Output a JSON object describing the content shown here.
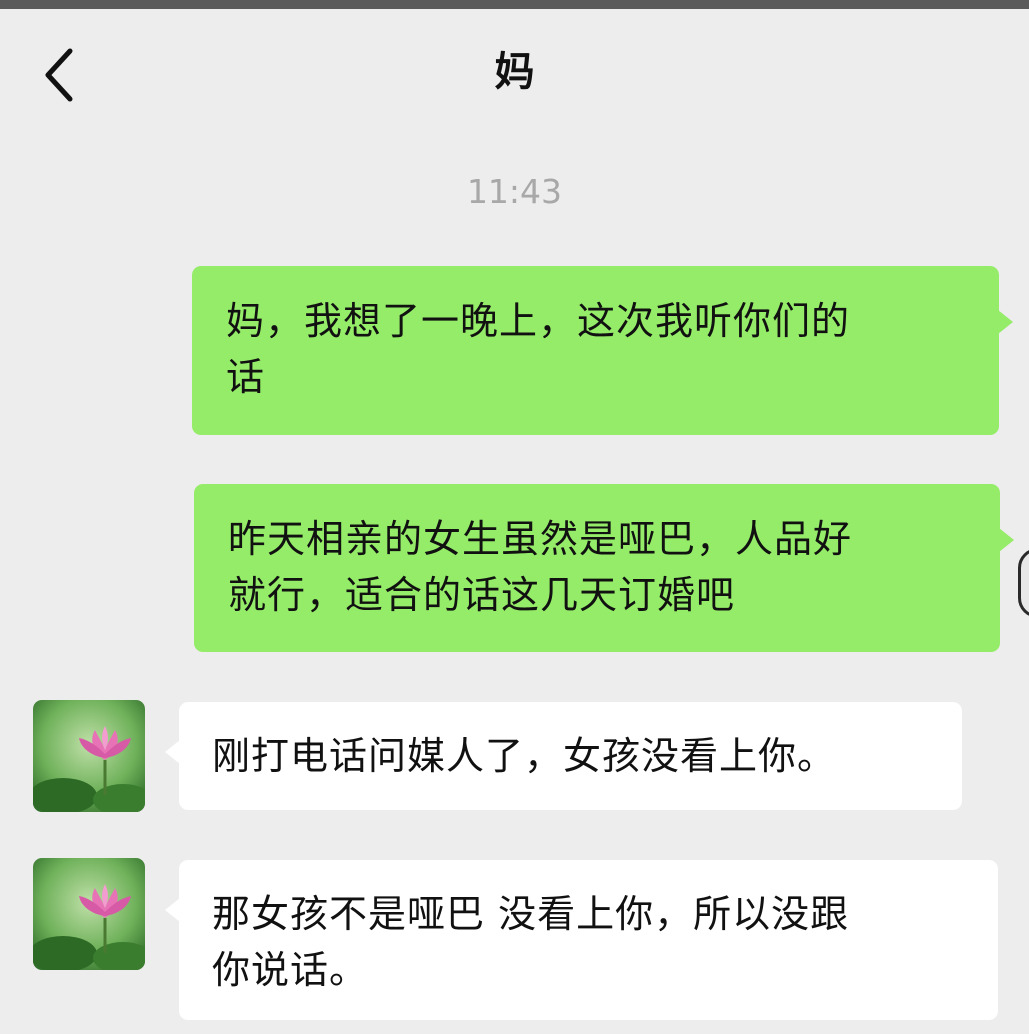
{
  "header": {
    "title": "妈",
    "back_icon": "chevron-left-icon"
  },
  "timestamp": "11:43",
  "messages": [
    {
      "side": "sent",
      "lines": [
        "妈，我想了一晚上，这次我听你们的",
        "话"
      ]
    },
    {
      "side": "sent",
      "lines": [
        "昨天相亲的女生虽然是哑巴，人品好",
        "就行，适合的话这几天订婚吧"
      ]
    },
    {
      "side": "received",
      "lines": [
        "刚打电话问媒人了，女孩没看上你。"
      ],
      "avatar": "lotus-avatar"
    },
    {
      "side": "received",
      "lines": [
        "那女孩不是哑巴 没看上你，所以没跟",
        "你说话。"
      ],
      "avatar": "lotus-avatar"
    }
  ],
  "colors": {
    "background": "#ededed",
    "sent_bubble": "#95ec69",
    "received_bubble": "#ffffff",
    "timestamp_text": "#a8a8a8"
  }
}
